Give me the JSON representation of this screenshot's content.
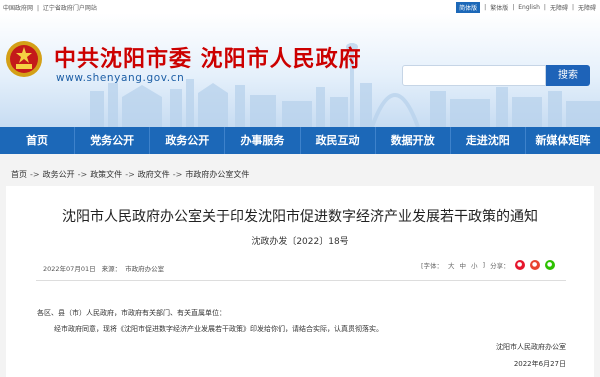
{
  "topbar": {
    "links": [
      "中国政府网",
      "|",
      "辽宁省政府门户网站"
    ],
    "right": [
      "简体版",
      "|",
      "繁体版",
      "|",
      "English",
      "|",
      "无障碍",
      "|",
      "无障碍"
    ]
  },
  "header": {
    "title": "中共沈阳市委  沈阳市人民政府",
    "url": "www.shenyang.gov.cn",
    "search_placeholder": "",
    "search_label": "搜索"
  },
  "nav": [
    "首页",
    "党务公开",
    "政务公开",
    "办事服务",
    "政民互动",
    "数据开放",
    "走进沈阳",
    "新媒体矩阵"
  ],
  "breadcrumb": [
    "首页",
    "政务公开",
    "政策文件",
    "政府文件",
    "市政府办公室文件"
  ],
  "breadcrumb_sep": "->",
  "article": {
    "title": "沈阳市人民政府办公室关于印发沈阳市促进数字经济产业发展若干政策的通知",
    "doc_number": "沈政办发〔2022〕18号",
    "date": "2022年07月01日",
    "source_label": "来源：",
    "source": "市政府办公室",
    "font_label": "[字体：",
    "font_sizes": [
      "大",
      "中",
      "小",
      "]"
    ],
    "share_label": "分享：",
    "recipients": "各区、县（市）人民政府，市政府有关部门、有关直属单位：",
    "body": "经市政府同意，现将《沈阳市促进数字经济产业发展若干政策》印发给你们，请结合实际，认真贯彻落实。",
    "signature": "沈阳市人民政府办公室",
    "sign_date": "2022年6月27日"
  },
  "colors": {
    "nav_bg": "#1c68b8",
    "title_red": "#cc0000",
    "weibo": "#e6162d",
    "qq": "#e8432f",
    "wechat": "#2dc100"
  }
}
